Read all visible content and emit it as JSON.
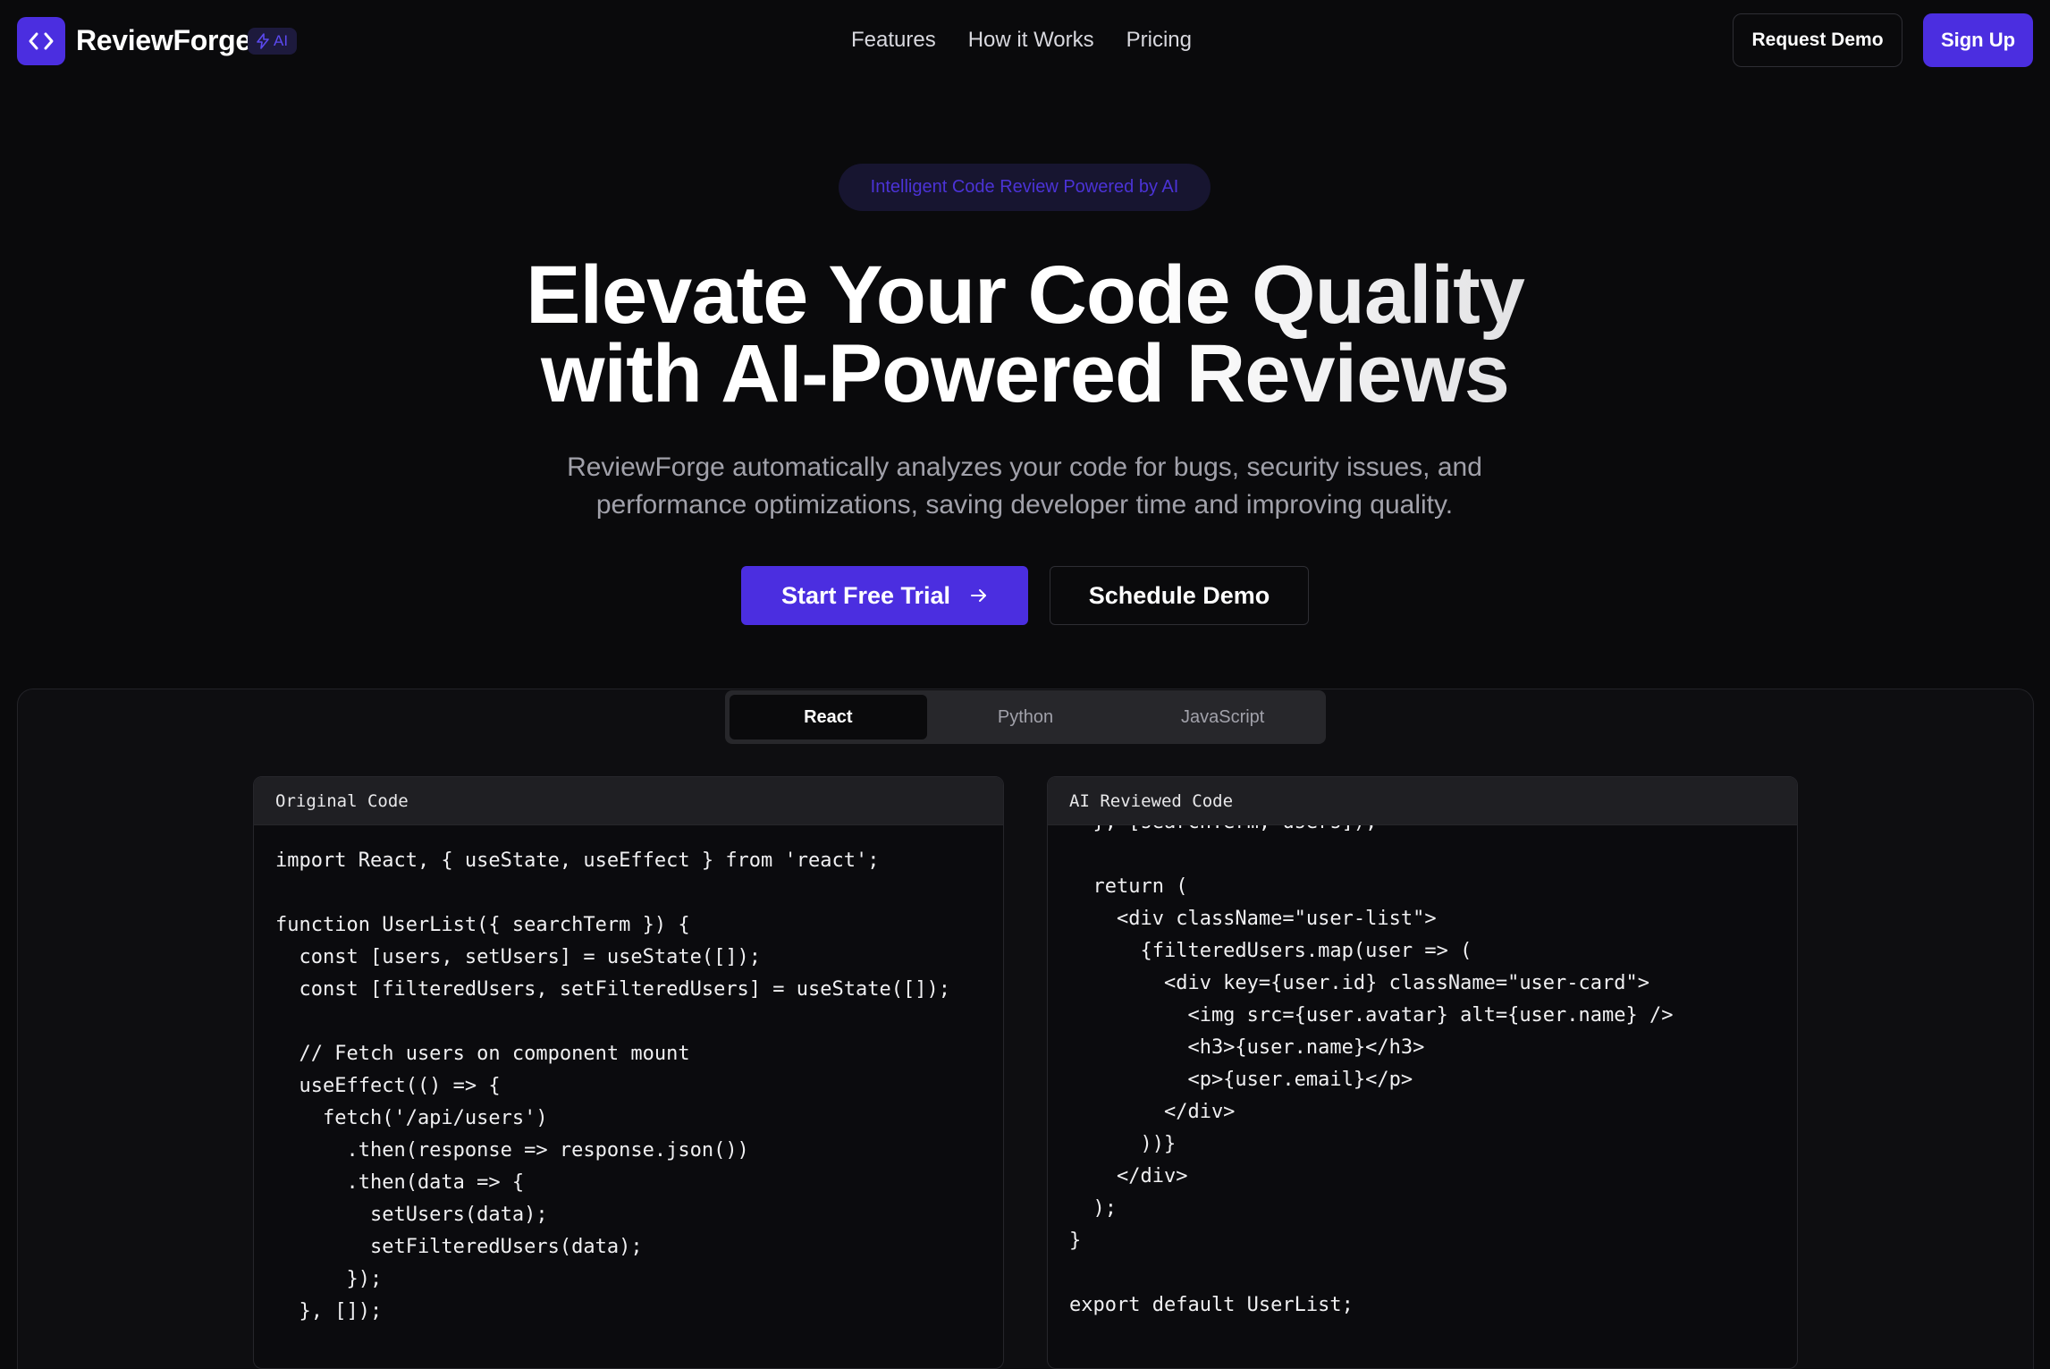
{
  "nav": {
    "brand": "ReviewForge",
    "badge": "AI",
    "links": [
      "Features",
      "How it Works",
      "Pricing"
    ],
    "request_demo": "Request Demo",
    "sign_up": "Sign Up"
  },
  "hero": {
    "pill": "Intelligent Code Review Powered by AI",
    "headline_line1": "Elevate Your Code Quality",
    "headline_line2": "with AI-Powered Reviews",
    "subhead": "ReviewForge automatically analyzes your code for bugs, security issues, and performance optimizations, saving developer time and improving quality.",
    "primary_cta": "Start Free Trial",
    "secondary_cta": "Schedule Demo"
  },
  "showcase": {
    "tabs": [
      {
        "label": "React",
        "active": true
      },
      {
        "label": "Python",
        "active": false
      },
      {
        "label": "JavaScript",
        "active": false
      }
    ],
    "original": {
      "title": "Original Code",
      "lines": [
        "import React, { useState, useEffect } from 'react';",
        "",
        "function UserList({ searchTerm }) {",
        "  const [users, setUsers] = useState([]);",
        "  const [filteredUsers, setFilteredUsers] = useState([]);",
        "",
        "  // Fetch users on component mount",
        "  useEffect(() => {",
        "    fetch('/api/users')",
        "      .then(response => response.json())",
        "      .then(data => {",
        "        setUsers(data);",
        "        setFilteredUsers(data);",
        "      });",
        "  }, []);",
        ""
      ]
    },
    "reviewed": {
      "title": "AI Reviewed Code",
      "lines": [
        "  }, [searchTerm, users]);",
        "",
        "  return (",
        "    <div className=\"user-list\">",
        "      {filteredUsers.map(user => (",
        "        <div key={user.id} className=\"user-card\">",
        "          <img src={user.avatar} alt={user.name} />",
        "          <h3>{user.name}</h3>",
        "          <p>{user.email}</p>",
        "        </div>",
        "      ))}",
        "    </div>",
        "  );",
        "}",
        "",
        "export default UserList;"
      ]
    }
  },
  "colors": {
    "background": "#0a0a0c",
    "accent": "#4b2ee0",
    "muted_text": "#a1a1aa"
  }
}
